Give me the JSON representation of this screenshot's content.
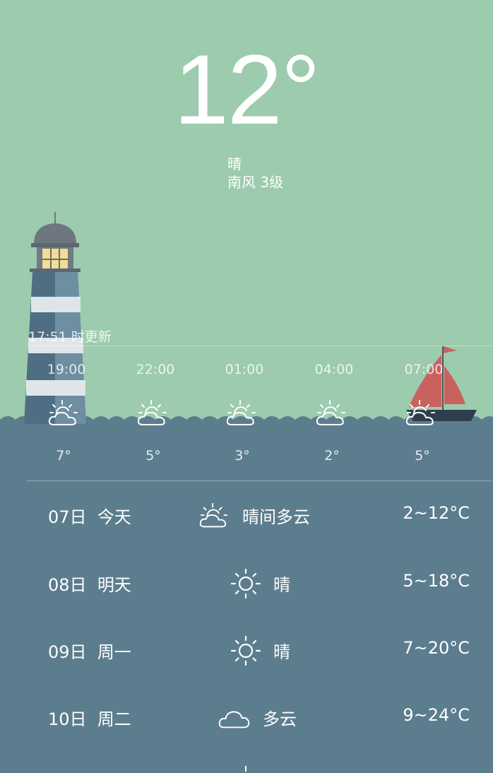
{
  "current": {
    "temperature": "12°",
    "condition": "晴",
    "wind": "南风 3级"
  },
  "updated": "17:51 时更新",
  "hourly": [
    {
      "time": "19:00",
      "icon": "partly-cloudy-icon",
      "temp": "7°"
    },
    {
      "time": "22:00",
      "icon": "partly-cloudy-icon",
      "temp": "5°"
    },
    {
      "time": "01:00",
      "icon": "partly-cloudy-icon",
      "temp": "3°"
    },
    {
      "time": "04:00",
      "icon": "partly-cloudy-icon",
      "temp": "2°"
    },
    {
      "time": "07:00",
      "icon": "partly-cloudy-icon",
      "temp": "5°"
    }
  ],
  "daily": [
    {
      "date": "07日",
      "weekday": "今天",
      "icon": "partly-cloudy-icon",
      "desc": "晴间多云",
      "range": "2~12°C"
    },
    {
      "date": "08日",
      "weekday": "明天",
      "icon": "sun-icon",
      "desc": "晴",
      "range": "5~18°C"
    },
    {
      "date": "09日",
      "weekday": "周一",
      "icon": "sun-icon",
      "desc": "晴",
      "range": "7~20°C"
    },
    {
      "date": "10日",
      "weekday": "周二",
      "icon": "cloud-icon",
      "desc": "多云",
      "range": "9~24°C"
    }
  ],
  "colors": {
    "sky": "#9ccbad",
    "sea": "#5c7d8d",
    "sail": "#c9625f",
    "text": "#ffffff"
  }
}
